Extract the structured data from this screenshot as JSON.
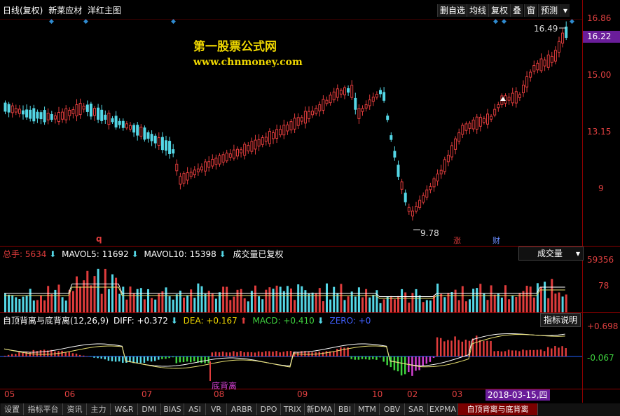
{
  "main": {
    "title_period": "日线(复权)",
    "stock_name": "新莱应材",
    "overlay": "洋红主图",
    "watermark_cn": "第一股票公式网",
    "watermark_url": "www.chnmoney.com",
    "high_label": "16.49",
    "low_label": "9.78",
    "event_q": "q",
    "event_zhang": "涨",
    "event_cai": "财"
  },
  "toolbar": {
    "delete_self": "删自选",
    "ma": "均线",
    "restore": "复权",
    "overlay": "叠",
    "window": "窗",
    "forecast": "预测",
    "dropdown": "▾"
  },
  "price_axis": {
    "p1": "16.86",
    "current": "16.22",
    "p2": "15.00",
    "p3": "13.15",
    "p4": "9"
  },
  "volume": {
    "total_label": "总手:",
    "total_value": "5634",
    "mavol5_label": "MAVOL5:",
    "mavol5_value": "11692",
    "mavol10_label": "MAVOL10:",
    "mavol10_value": "15398",
    "note": "成交量已复权",
    "dropdown_label": "成交量",
    "axis_top": "59356",
    "axis_mid": "78"
  },
  "macd": {
    "name": "自顶背离与底背离(12,26,9)",
    "diff_label": "DIFF:",
    "diff_value": "+0.372",
    "dea_label": "DEA:",
    "dea_value": "+0.167",
    "macd_label": "MACD:",
    "macd_value": "+0.410",
    "zero_label": "ZERO:",
    "zero_value": "+0",
    "help_button": "指标说明",
    "axis_top": "+0.698",
    "axis_zero": "-0.067",
    "divergence_label": "底背离"
  },
  "time_axis": {
    "months": [
      "05",
      "06",
      "07",
      "08",
      "09",
      "10",
      "02",
      "03"
    ],
    "cursor_date": "2018-03-15,四"
  },
  "bottom_tabs": [
    "设置",
    "指标平台",
    "资讯",
    "主力",
    "W&R",
    "DMI",
    "BIAS",
    "ASI",
    "VR",
    "ARBR",
    "DPO",
    "TRIX",
    "新DMA",
    "BBI",
    "MTM",
    "OBV",
    "SAR",
    "EXPMA",
    "自顶背离与底背离"
  ],
  "active_tab": "自顶背离与底背离",
  "colors": {
    "up": "#e03c3c",
    "down": "#54d7e6",
    "grid": "#8b0000",
    "macd_green": "#3fd33f",
    "macd_magenta": "#d040d0",
    "current_price_bg": "#6a1d9a"
  }
}
